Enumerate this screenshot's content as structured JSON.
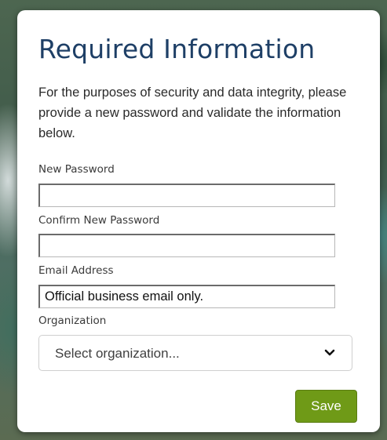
{
  "form": {
    "title": "Required Information",
    "intro": "For the purposes of security and data integrity, please provide a new password and validate the information below.",
    "fields": {
      "new_password": {
        "label": "New Password",
        "value": "",
        "placeholder": ""
      },
      "confirm_password": {
        "label": "Confirm New Password",
        "value": "",
        "placeholder": ""
      },
      "email": {
        "label": "Email Address",
        "value": "",
        "placeholder": "Official business email only."
      },
      "organization": {
        "label": "Organization",
        "selected": "Select organization...",
        "icon": "chevron-down-icon"
      }
    },
    "save_label": "Save"
  },
  "colors": {
    "title": "#1e3f66",
    "save_button": "#6f9a17",
    "card_background": "#ffffff"
  }
}
